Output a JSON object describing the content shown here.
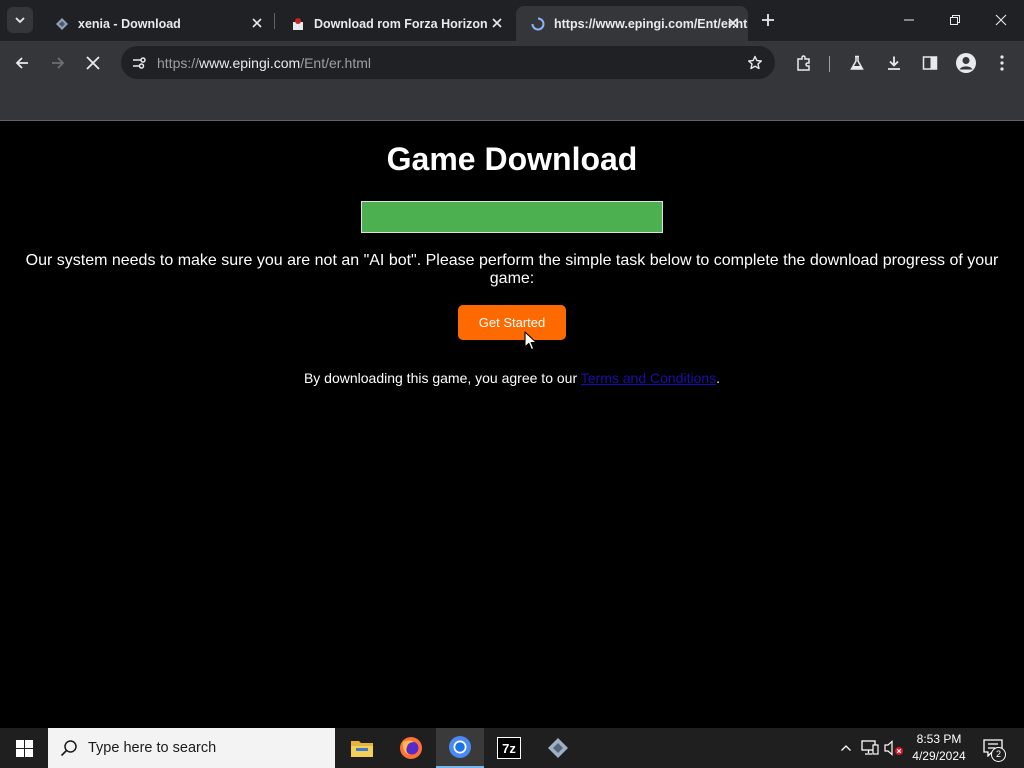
{
  "browser": {
    "tabs": [
      {
        "title": "xenia - Download",
        "favicon": "xenia-icon",
        "active": false
      },
      {
        "title": "Download rom Forza Horizon ",
        "favicon": "rom-site-icon",
        "active": false
      },
      {
        "title": "https://www.epingi.com/Ent/er.html",
        "favicon": "loading-icon",
        "active": true
      }
    ],
    "address": {
      "scheme": "https://",
      "host": "www.epingi.com",
      "path": "/Ent/er.html"
    }
  },
  "page": {
    "heading": "Game Download",
    "progress": 1.0,
    "progress_color": "#4caf50",
    "notice": "Our system needs to make sure you are not an \"AI bot\". Please perform the simple task below to complete the download progress of your game:",
    "cta_label": "Get Started",
    "cta_color": "#ff6a00",
    "legal_prefix": "By downloading this game, you agree to our ",
    "legal_link": "Terms and Conditions",
    "legal_suffix": "."
  },
  "taskbar": {
    "search_placeholder": "Type here to search",
    "apps": [
      "file-explorer-icon",
      "firefox-icon",
      "chrome-icon",
      "7zip-icon",
      "xenia-icon"
    ],
    "app_7zip_label": "7z",
    "time": "8:53 PM",
    "date": "4/29/2024",
    "notification_count": "2"
  }
}
